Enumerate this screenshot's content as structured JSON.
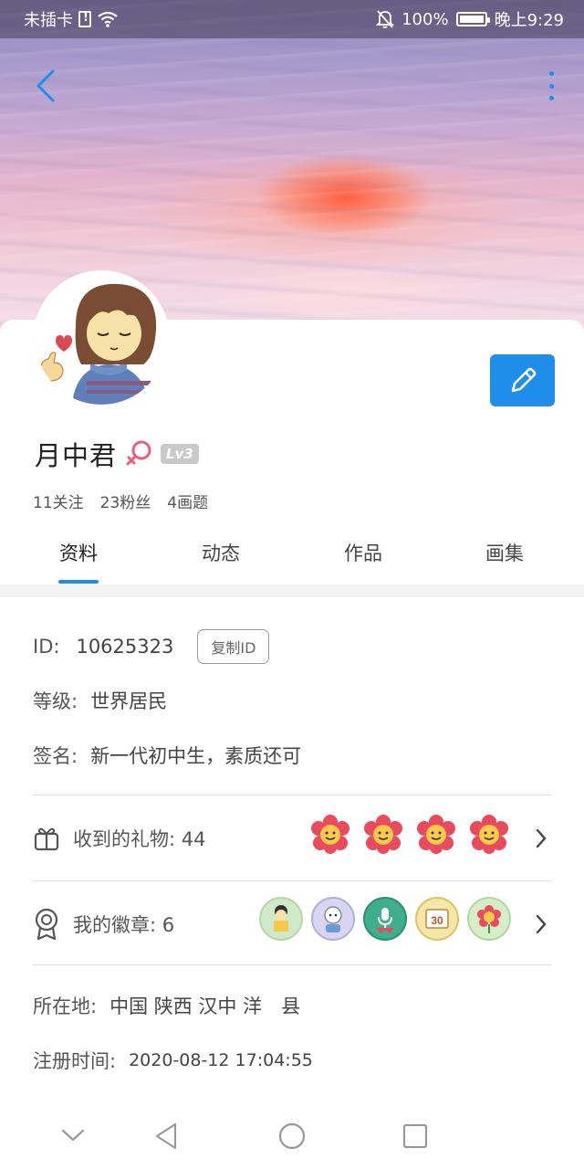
{
  "status_bar": {
    "carrier": "未插卡",
    "battery": "100%",
    "time": "晚上9:29"
  },
  "profile": {
    "name": "月中君",
    "level": "Lv3",
    "follows": "11关注",
    "fans": "23粉丝",
    "topics": "4画题"
  },
  "tabs": [
    {
      "label": "资料"
    },
    {
      "label": "动态"
    },
    {
      "label": "作品"
    },
    {
      "label": "画集"
    }
  ],
  "info": {
    "id_label": "ID:",
    "id_value": "10625323",
    "copy_label": "复制ID",
    "level_label": "等级:",
    "level_value": "世界居民",
    "sign_label": "签名:",
    "sign_value": "新一代初中生，素质还可",
    "gifts_label": "收到的礼物: 44",
    "badges_label": "我的徽章: 6",
    "location_label": "所在地:",
    "location_value": "中国 陕西 汉中 洋　县",
    "register_label": "注册时间:",
    "register_value": "2020-08-12 17:04:55"
  },
  "colors": {
    "accent": "#1e8eea",
    "gender": "#e8607a"
  },
  "icons": {
    "back": "back-icon",
    "more": "more-icon",
    "edit": "pencil-icon",
    "gift": "gift-icon",
    "badge": "medal-icon"
  }
}
